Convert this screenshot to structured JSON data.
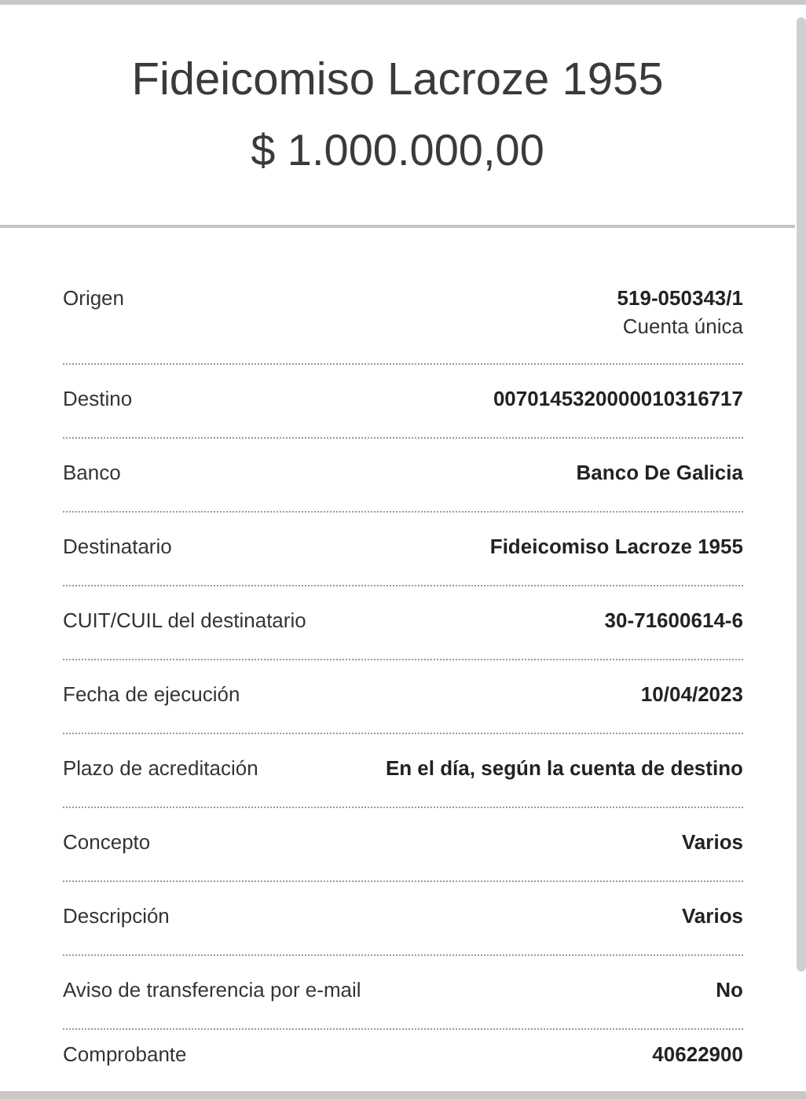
{
  "header": {
    "title": "Fideicomiso Lacroze 1955",
    "amount": "$ 1.000.000,00"
  },
  "details": [
    {
      "label": "Origen",
      "values": [
        "519-050343/1",
        "Cuenta única"
      ]
    },
    {
      "label": "Destino",
      "values": [
        "0070145320000010316717"
      ]
    },
    {
      "label": "Banco",
      "values": [
        "Banco De Galicia"
      ]
    },
    {
      "label": "Destinatario",
      "values": [
        "Fideicomiso Lacroze 1955"
      ]
    },
    {
      "label": "CUIT/CUIL del destinatario",
      "values": [
        "30-71600614-6"
      ]
    },
    {
      "label": "Fecha de ejecución",
      "values": [
        "10/04/2023"
      ]
    },
    {
      "label": "Plazo de acreditación",
      "values": [
        "En el día, según la cuenta de destino"
      ]
    },
    {
      "label": "Concepto",
      "values": [
        "Varios"
      ]
    },
    {
      "label": "Descripción",
      "values": [
        "Varios"
      ]
    },
    {
      "label": "Aviso de transferencia por e-mail",
      "values": [
        "No"
      ]
    },
    {
      "label": "Comprobante",
      "values": [
        "40622900"
      ]
    }
  ]
}
